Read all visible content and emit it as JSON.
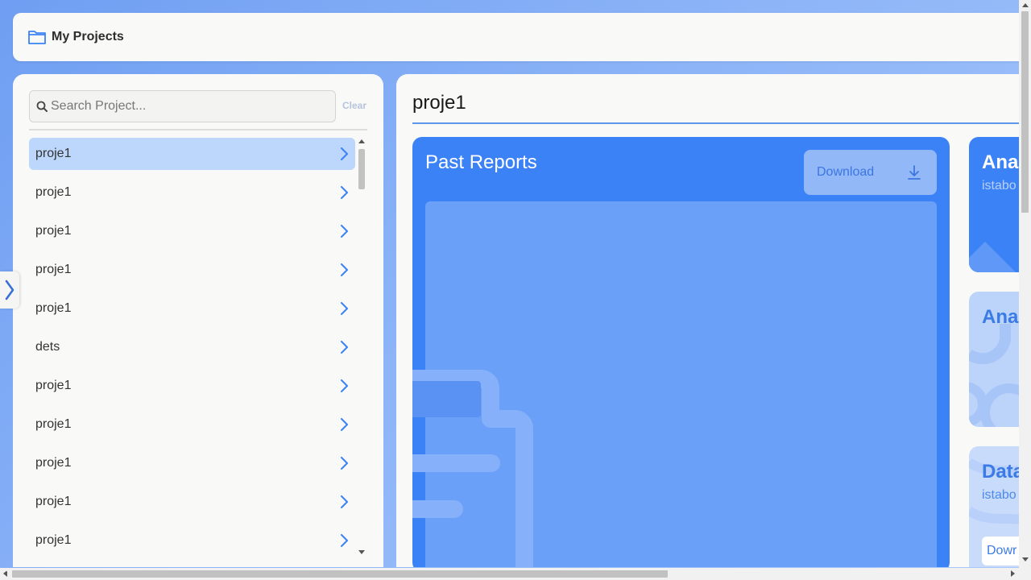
{
  "header": {
    "title": "My Projects",
    "icon": "folder-icon"
  },
  "sidebar": {
    "search": {
      "placeholder": "Search Project...",
      "value": ""
    },
    "clear_label": "Clear",
    "items": [
      {
        "label": "proje1",
        "selected": true
      },
      {
        "label": "proje1"
      },
      {
        "label": "proje1"
      },
      {
        "label": "proje1"
      },
      {
        "label": "proje1"
      },
      {
        "label": "dets"
      },
      {
        "label": "proje1"
      },
      {
        "label": "proje1"
      },
      {
        "label": "proje1"
      },
      {
        "label": "proje1"
      },
      {
        "label": "proje1"
      }
    ]
  },
  "main": {
    "project_title": "proje1",
    "reports": {
      "title": "Past Reports",
      "download_label": "Download"
    },
    "cards": [
      {
        "title": "Ana",
        "subtitle": "istabo"
      },
      {
        "title": "Ana"
      },
      {
        "title": "Data",
        "subtitle": "istabo",
        "button": "Dowr"
      }
    ]
  },
  "colors": {
    "accent": "#3b82f6",
    "selected_item": "#bcd7fb",
    "panel_bg": "#f9f9f7"
  }
}
